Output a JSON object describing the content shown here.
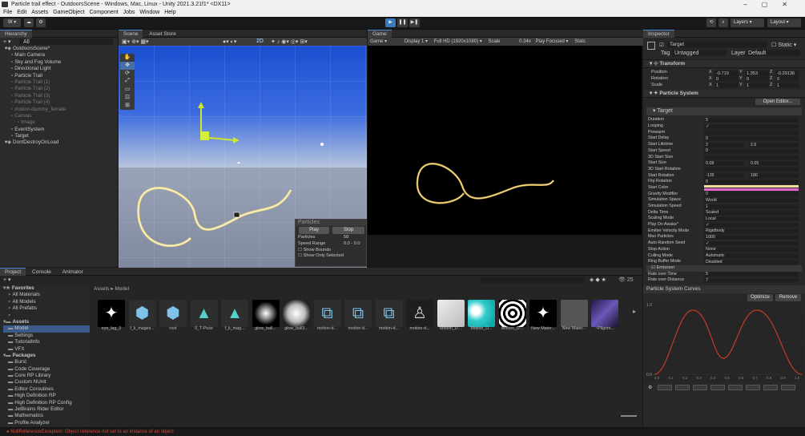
{
  "window": {
    "title": "Particle trail effect - OutdoorsScene - Windows, Mac, Linux - Unity 2021.3.21f1* <DX11>"
  },
  "menu": [
    "File",
    "Edit",
    "Assets",
    "GameObject",
    "Component",
    "Jobs",
    "Window",
    "Help"
  ],
  "toolbar": {
    "account": "W",
    "layers_label": "Layers",
    "layout_label": "Layout"
  },
  "hierarchy": {
    "tab": "Hierarchy",
    "search_label": "All",
    "items": [
      {
        "label": "OutdoorsScene*",
        "state": "scene"
      },
      {
        "label": "Main Camera",
        "state": "normal"
      },
      {
        "label": "Sky and Fog Volume",
        "state": "normal"
      },
      {
        "label": "Directional Light",
        "state": "normal"
      },
      {
        "label": "Particle Trail",
        "state": "normal"
      },
      {
        "label": "Particle Trail (1)",
        "state": "dim"
      },
      {
        "label": "Particle Trail (2)",
        "state": "dim"
      },
      {
        "label": "Particle Trail (3)",
        "state": "dim"
      },
      {
        "label": "Particle Trail (4)",
        "state": "dim"
      },
      {
        "label": "motion-dummy_female",
        "state": "dim"
      },
      {
        "label": "Canvas",
        "state": "dim"
      },
      {
        "label": "Image",
        "state": "dim"
      },
      {
        "label": "EventSystem",
        "state": "normal"
      },
      {
        "label": "Target",
        "state": "normal"
      },
      {
        "label": "DontDestroyOnLoad",
        "state": "scene"
      }
    ]
  },
  "scene": {
    "tabs": [
      "Scene",
      "Asset Store"
    ],
    "mode_2d": "2D",
    "particles_overlay": {
      "title": "Particles",
      "play": "Play",
      "stop": "Stop",
      "particles_label": "Particles",
      "particles_value": "58",
      "speed_label": "Speed Range",
      "speed_value": "0.0 - 0.0",
      "show_bounds": "Show Bounds",
      "show_selected": "Show Only Selected"
    }
  },
  "game": {
    "tab": "Game",
    "mode": "Game",
    "display": "Display 1",
    "resolution": "Full HD (1920x1080)",
    "scale_label": "Scale",
    "scale_value": "0.34x",
    "play_focused": "Play Focused",
    "stats": "Stats"
  },
  "inspector": {
    "tab": "Inspector",
    "object_name": "Target",
    "static_label": "Static",
    "tag_label": "Tag",
    "tag_value": "Untagged",
    "layer_label": "Layer",
    "layer_value": "Default",
    "transform": {
      "title": "Transform",
      "position": {
        "label": "Position",
        "x": "-0.719",
        "y": "1.353",
        "z": "-0.29136"
      },
      "rotation": {
        "label": "Rotation",
        "x": "0",
        "y": "0",
        "z": "0"
      },
      "scale": {
        "label": "Scale",
        "x": "1",
        "y": "1",
        "z": "1"
      }
    },
    "particle_system": {
      "title": "Particle System",
      "open_editor": "Open Editor...",
      "module": "Target",
      "rows": [
        {
          "label": "Duration",
          "value": "5"
        },
        {
          "label": "Looping",
          "value": "✓"
        },
        {
          "label": "Prewarm",
          "value": ""
        },
        {
          "label": "Start Delay",
          "value": "0"
        },
        {
          "label": "Start Lifetime",
          "value": "2",
          "value2": "2.5"
        },
        {
          "label": "Start Speed",
          "value": "0"
        },
        {
          "label": "3D Start Size",
          "value": ""
        },
        {
          "label": "Start Size",
          "value": "0.08",
          "value2": "0.05"
        },
        {
          "label": "3D Start Rotation",
          "value": ""
        },
        {
          "label": "Start Rotation",
          "value": "-135",
          "value2": "180"
        },
        {
          "label": "Flip Rotation",
          "value": "0"
        },
        {
          "label": "Start Color",
          "value": "",
          "swatch": "#f3dca0",
          "swatch2": "#e06ad2"
        },
        {
          "label": "Gravity Modifier",
          "value": "0"
        },
        {
          "label": "Simulation Space",
          "value": "World"
        },
        {
          "label": "Simulation Speed",
          "value": "1"
        },
        {
          "label": "Delta Time",
          "value": "Scaled"
        },
        {
          "label": "Scaling Mode",
          "value": "Local"
        },
        {
          "label": "Play On Awake*",
          "value": "✓"
        },
        {
          "label": "Emitter Velocity Mode",
          "value": "Rigidbody"
        },
        {
          "label": "Max Particles",
          "value": "1000"
        },
        {
          "label": "Auto Random Seed",
          "value": "✓"
        },
        {
          "label": "Stop Action",
          "value": "None"
        },
        {
          "label": "Culling Mode",
          "value": "Automatic"
        },
        {
          "label": "Ring Buffer Mode",
          "value": "Disabled"
        }
      ],
      "emission": {
        "title": "Emission",
        "rows": [
          {
            "label": "Rate over Time",
            "value": "5"
          },
          {
            "label": "Rate over Distance",
            "value": "7"
          }
        ]
      }
    },
    "curves": {
      "title": "Particle System Curves",
      "optimize": "Optimize",
      "remove": "Remove",
      "y_max": "1.0",
      "y_min": "0.0",
      "x_ticks": [
        "0.0",
        "0.1",
        "0.2",
        "0.3",
        "0.4",
        "0.5",
        "0.6",
        "0.7",
        "0.8",
        "0.9",
        "1.0"
      ]
    }
  },
  "project": {
    "tabs": [
      "Project",
      "Console",
      "Animator"
    ],
    "breadcrumb": [
      "Assets",
      "Model"
    ],
    "count": "25",
    "tree": [
      {
        "label": "Favorites",
        "level": 0,
        "bold": true
      },
      {
        "label": "All Materials",
        "level": 1
      },
      {
        "label": "All Models",
        "level": 1
      },
      {
        "label": "All Prefabs",
        "level": 1
      },
      {
        "label": "",
        "level": 1
      },
      {
        "label": "Assets",
        "level": 0,
        "bold": true
      },
      {
        "label": "Model",
        "level": 1,
        "selected": true
      },
      {
        "label": "Settings",
        "level": 1
      },
      {
        "label": "TutorialInfo",
        "level": 1
      },
      {
        "label": "VFX",
        "level": 1
      },
      {
        "label": "Packages",
        "level": 0,
        "bold": true
      },
      {
        "label": "Burst",
        "level": 1
      },
      {
        "label": "Code Coverage",
        "level": 1
      },
      {
        "label": "Core RP Library",
        "level": 1
      },
      {
        "label": "Custom NUnit",
        "level": 1
      },
      {
        "label": "Editor Coroutines",
        "level": 1
      },
      {
        "label": "High Definition RP",
        "level": 1
      },
      {
        "label": "High Definition RP Config",
        "level": 1
      },
      {
        "label": "JetBrains Rider Editor",
        "level": 1
      },
      {
        "label": "Mathematics",
        "level": 1
      },
      {
        "label": "Profile Analyzer",
        "level": 1
      }
    ],
    "assets": [
      {
        "label": "eye_lag_3",
        "kind": "spark"
      },
      {
        "label": "f_k_mages...",
        "kind": "cube"
      },
      {
        "label": "root",
        "kind": "cube"
      },
      {
        "label": "0_T-Pose",
        "kind": "tri"
      },
      {
        "label": "f_k_mag...",
        "kind": "tri"
      },
      {
        "label": "glow_ball...",
        "kind": "glow"
      },
      {
        "label": "glow_ball3...",
        "kind": "glow2"
      },
      {
        "label": "motion-d...",
        "kind": "anim"
      },
      {
        "label": "motion-d...",
        "kind": "anim"
      },
      {
        "label": "motion-d...",
        "kind": "anim"
      },
      {
        "label": "motion-d...",
        "kind": "figure"
      },
      {
        "label": "Motion_D...",
        "kind": "tex_white"
      },
      {
        "label": "Motion_D...",
        "kind": "tex_cyan"
      },
      {
        "label": "Motion_D...",
        "kind": "tex_bw"
      },
      {
        "label": "New Mater...",
        "kind": "spark"
      },
      {
        "label": "New Mater...",
        "kind": "gray"
      },
      {
        "label": "~Pilgrim...",
        "kind": "purple"
      }
    ]
  },
  "status": {
    "text": "NullReferenceException: Object reference not set to an instance of an object"
  }
}
